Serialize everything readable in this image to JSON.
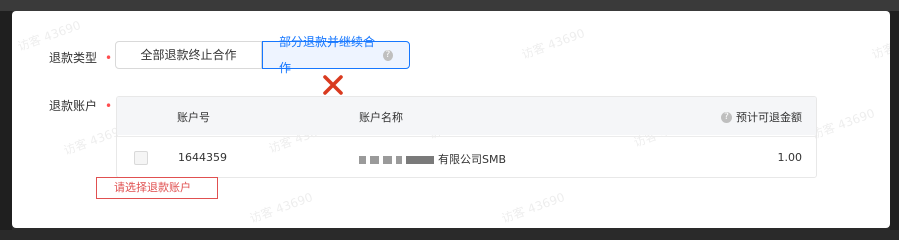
{
  "form": {
    "refund_type_label": "退款类型",
    "refund_account_label": "退款账户",
    "required_mark": "•",
    "options": [
      "全部退款终止合作",
      "部分退款并继续合作"
    ],
    "help_glyph": "?",
    "error_message": "请选择退款账户"
  },
  "table": {
    "columns": [
      "账户号",
      "账户名称",
      "预计可退金额"
    ],
    "rows": [
      {
        "account_no": "1644359",
        "account_name": "有限公司SMB",
        "amount": "1.00"
      }
    ]
  },
  "watermark": "访客 43690",
  "colors": {
    "primary": "#1677ff",
    "error": "#e05050",
    "required": "#ff4d4f",
    "xmark": "#d93a1f"
  }
}
